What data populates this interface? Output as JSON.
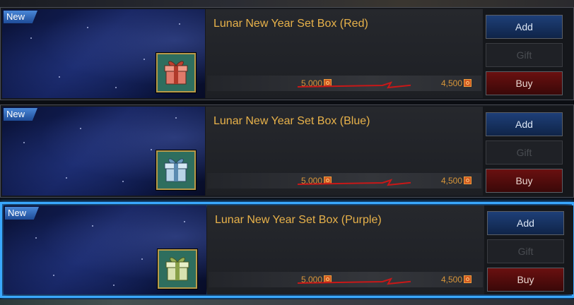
{
  "items": [
    {
      "badge": "New",
      "name": "Lunar New Year Set Box (Red)",
      "icon": "gift-box-red-icon",
      "box_color": "#e07a6a",
      "ribbon_color": "#b03a2a",
      "original_price": "5,000",
      "sale_price": "4,500",
      "currency_icon": "coin-icon",
      "buttons": {
        "add": "Add",
        "gift": "Gift",
        "buy": "Buy"
      }
    },
    {
      "badge": "New",
      "name": "Lunar New Year Set Box (Blue)",
      "icon": "gift-box-blue-icon",
      "box_color": "#b8d4e8",
      "ribbon_color": "#5a8ab0",
      "original_price": "5,000",
      "sale_price": "4,500",
      "currency_icon": "coin-icon",
      "buttons": {
        "add": "Add",
        "gift": "Gift",
        "buy": "Buy"
      }
    },
    {
      "badge": "New",
      "name": "Lunar New Year Set Box (Purple)",
      "icon": "gift-box-purple-icon",
      "box_color": "#d8e2b0",
      "ribbon_color": "#88a048",
      "original_price": "5,000",
      "sale_price": "4,500",
      "currency_icon": "coin-icon",
      "buttons": {
        "add": "Add",
        "gift": "Gift",
        "buy": "Buy"
      },
      "selected": true
    }
  ],
  "colors": {
    "title": "#e8b24a",
    "price": "#d8963a",
    "selection": "#3aa8ff",
    "arrow": "#c81818"
  }
}
